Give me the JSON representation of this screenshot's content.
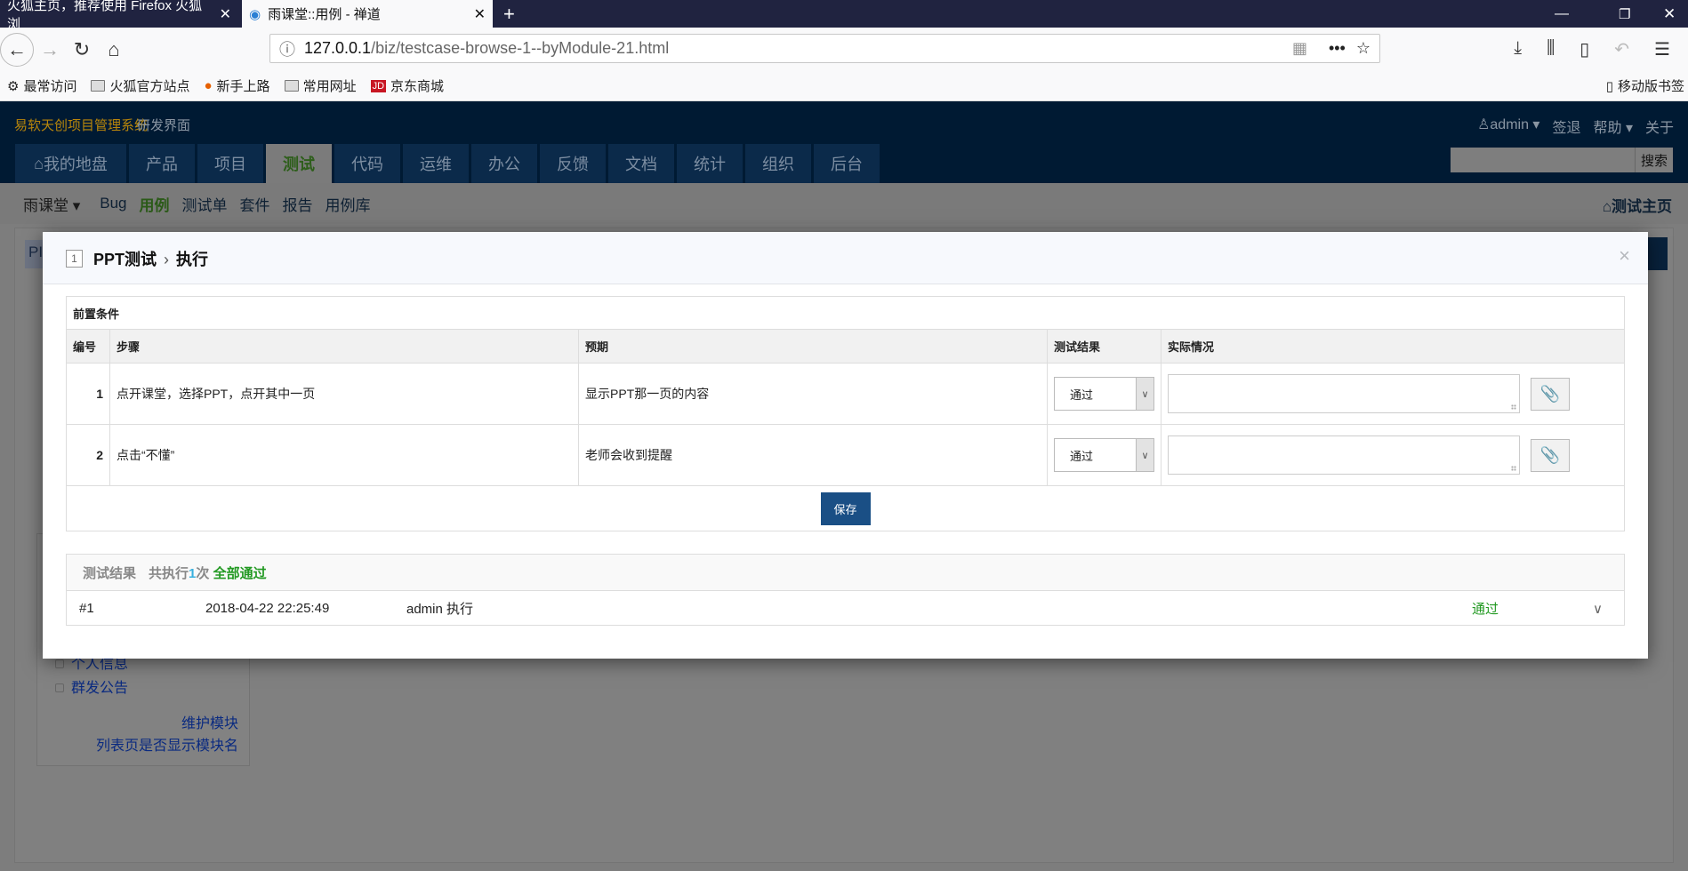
{
  "browser": {
    "tabs": [
      {
        "title": "火狐主页，推荐使用 Firefox 火狐浏"
      },
      {
        "title": "雨课堂::用例 - 禅道"
      }
    ],
    "url_host": "127.0.0.1",
    "url_path": "/biz/testcase-browse-1--byModule-21.html",
    "bookmarks": [
      "最常访问",
      "火狐官方站点",
      "新手上路",
      "常用网址",
      "京东商城"
    ],
    "mobile_bookmarks": "移动版书签"
  },
  "app": {
    "brand": "易软天创项目管理系统",
    "mode": "研发界面",
    "user": "admin",
    "logout": "签退",
    "help": "帮助",
    "about": "关于",
    "main_tabs": [
      "我的地盘",
      "产品",
      "项目",
      "测试",
      "代码",
      "运维",
      "办公",
      "反馈",
      "文档",
      "统计",
      "组织",
      "后台"
    ],
    "active_tab": "测试",
    "search_button": "搜索",
    "subnav": {
      "product": "雨课堂",
      "items": [
        "Bug",
        "用例",
        "测试单",
        "套件",
        "报告",
        "用例库"
      ],
      "active": "用例",
      "home": "测试主页"
    },
    "left_panel": {
      "items": [
        "个人信息",
        "群发公告"
      ],
      "links": [
        "维护模块",
        "列表页是否显示模块名"
      ]
    },
    "bg_button_text": "PI"
  },
  "modal": {
    "case_id": "1",
    "case_title": "PPT测试",
    "action": "执行",
    "precondition_label": "前置条件",
    "columns": [
      "编号",
      "步骤",
      "预期",
      "测试结果",
      "实际情况"
    ],
    "steps": [
      {
        "num": "1",
        "step": "点开课堂，选择PPT，点开其中一页",
        "expect": "显示PPT那一页的内容",
        "result": "通过"
      },
      {
        "num": "2",
        "step": "点击“不懂”",
        "expect": "老师会收到提醒",
        "result": "通过"
      }
    ],
    "save": "保存",
    "results": {
      "label": "测试结果",
      "count_prefix": "共执行",
      "count": "1",
      "count_suffix": "次",
      "summary": "全部通过",
      "runs": [
        {
          "id": "#1",
          "date": "2018-04-22 22:25:49",
          "by": "admin 执行",
          "result": "通过"
        }
      ]
    }
  },
  "colors": {
    "header": "#001a33",
    "save": "#1a4f85",
    "pass": "#229922"
  }
}
